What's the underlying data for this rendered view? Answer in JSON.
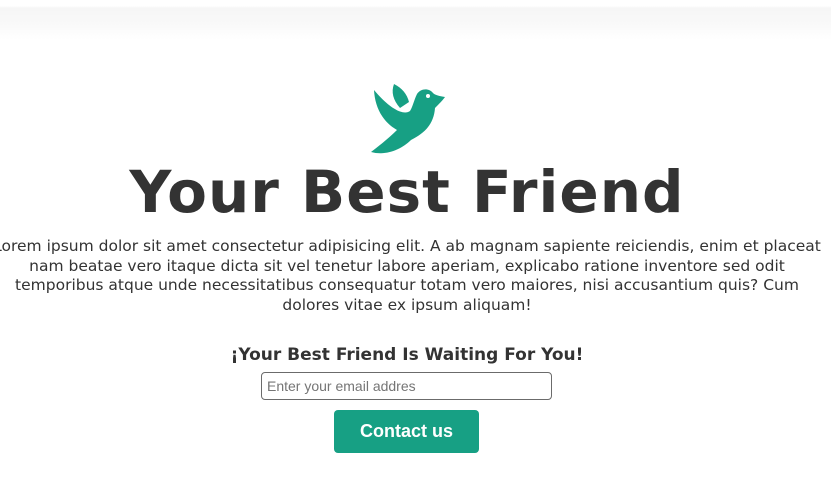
{
  "hero": {
    "logo_icon": "bird-icon",
    "title": "Your Best Friend",
    "description_lines": [
      "Lorem ipsum dolor sit amet consectetur adipisicing elit. A ab magnam sapiente reiciendis, enim et placeat",
      "nam beatae vero itaque dicta sit vel tenetur labore aperiam, explicabo ratione inventore sed odit",
      "temporibus atque unde necessitatibus consequatur totam vero maiores, nisi accusantium quis? Cum",
      "dolores vitae ex ipsum aliquam!"
    ]
  },
  "signup": {
    "heading": "¡Your Best Friend Is Waiting For You!",
    "email_placeholder": "Enter your email addres",
    "email_value": "",
    "submit_label": "Contact us"
  },
  "colors": {
    "accent": "#17a084",
    "text": "#333333",
    "background": "#ffffff"
  }
}
